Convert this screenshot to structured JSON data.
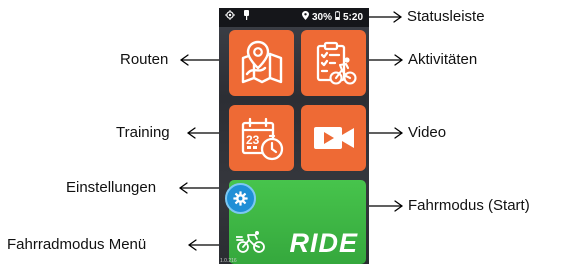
{
  "labels": {
    "statusleiste": "Statusleiste",
    "routen": "Routen",
    "aktivitaeten": "Aktivitäten",
    "training": "Training",
    "video": "Video",
    "einstellungen": "Einstellungen",
    "fahrmodus": "Fahrmodus (Start)",
    "fahrradmodus_menu": "Fahrradmodus Menü"
  },
  "device": {
    "status_bar": {
      "battery": "30%",
      "time": "5:20",
      "left_icons": [
        "gps-icon",
        "pin-icon"
      ],
      "right_icons": [
        "location-icon",
        "battery-icon"
      ]
    },
    "tiles": [
      {
        "id": "routen",
        "icon": "map-pin-icon"
      },
      {
        "id": "aktivitaeten",
        "icon": "clipboard-cyclist-icon"
      },
      {
        "id": "training",
        "icon": "calendar-timer-icon"
      },
      {
        "id": "video",
        "icon": "video-camera-icon"
      }
    ],
    "ride_button": {
      "label": "RIDE",
      "icon": "cyclist-icon"
    },
    "settings_icon": "gear-icon",
    "version": "1.0.216"
  },
  "colors": {
    "tile_orange": "#ee6a35",
    "ride_green": "#3cb443",
    "settings_blue": "#1f8fd6",
    "status_bar": "#15161a"
  }
}
